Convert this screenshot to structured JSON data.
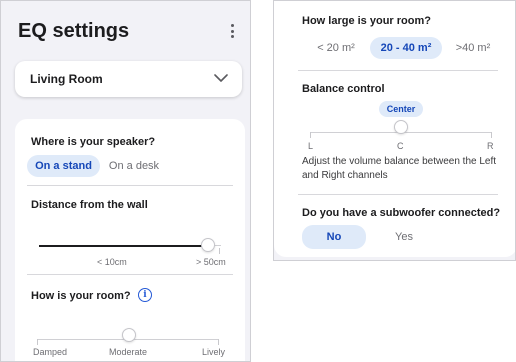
{
  "left": {
    "title": "EQ settings",
    "room_select": {
      "value": "Living Room"
    },
    "speaker_placement": {
      "label": "Where is your speaker?",
      "options": [
        "On a stand",
        "On a desk"
      ],
      "selected": "On a stand"
    },
    "distance": {
      "label": "Distance from the wall",
      "min_label": "< 10cm",
      "max_label": "> 50cm",
      "value_fraction": 0.93
    },
    "room_sound": {
      "label": "How is your room?",
      "stops": [
        "Damped",
        "Moderate",
        "Lively"
      ],
      "selected": "Moderate"
    }
  },
  "right": {
    "room_size": {
      "label": "How large is your room?",
      "options": [
        "< 20 m²",
        "20 - 40 m²",
        ">40 m²"
      ],
      "selected": "20 - 40 m²"
    },
    "balance": {
      "label": "Balance control",
      "value_badge": "Center",
      "ticks": [
        "L",
        "C",
        "R"
      ],
      "value_fraction": 0.5,
      "description": "Adjust the volume balance between the Left and Right channels"
    },
    "subwoofer": {
      "label": "Do you have a subwoofer connected?",
      "options": [
        "No",
        "Yes"
      ],
      "selected": "No"
    }
  },
  "colors": {
    "accent": "#1547b8",
    "accent_bg": "#dfeaf9",
    "background": "#f2f2f7",
    "card": "#ffffff"
  },
  "icons": {
    "menu": "more-vertical-icon",
    "dropdown": "chevron-down-icon",
    "info": "info-icon"
  }
}
